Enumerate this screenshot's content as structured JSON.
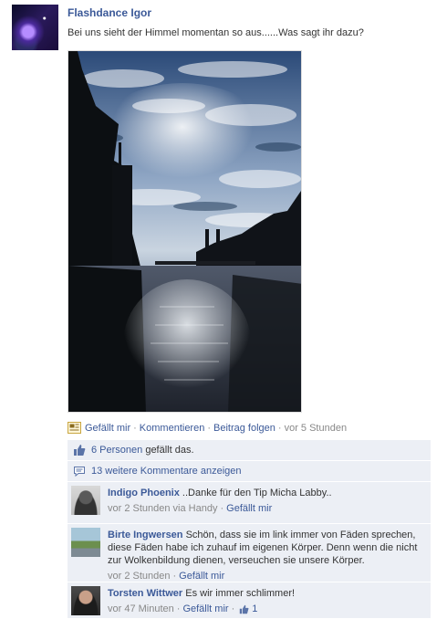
{
  "post": {
    "author": "Flashdance Igor",
    "text": "Bei uns sieht der Himmel momentan so aus......Was sagt ihr dazu?",
    "avatar_icon": "galaxy-avatar",
    "photo_icon": "river-sky-photo"
  },
  "actions": {
    "like": "Gefällt mir",
    "comment": "Kommentieren",
    "follow": "Beitrag folgen",
    "separator": "·",
    "time": "vor 5 Stunden"
  },
  "likes": {
    "count_link": "6 Personen",
    "suffix": " gefällt das.",
    "icon": "thumbs-up-icon"
  },
  "more_comments": {
    "label": "13 weitere Kommentare anzeigen",
    "icon": "comment-bubble-icon"
  },
  "comments": [
    {
      "author": "Indigo Phoenix",
      "text": " ..Danke für den Tip Micha Labby..",
      "time": "vor 2 Stunden via Handy",
      "like": "Gefällt mir"
    },
    {
      "author": "Birte Ingwersen",
      "text": " Schön, dass sie im link immer von Fäden sprechen, diese Fäden habe ich zuhauf im eigenen Körper. Denn wenn die nicht zur Wolkenbildung dienen, verseuchen sie unsere Körper.",
      "time": "vor 2 Stunden",
      "like": "Gefällt mir"
    },
    {
      "author": "Torsten Wittwer",
      "text": " Es wir immer schlimmer!",
      "time": "vor 47 Minuten",
      "like": "Gefällt mir",
      "like_count": "1"
    }
  ],
  "colors": {
    "link": "#3b5998",
    "ufi_background": "#eceff5",
    "meta_text": "#888888"
  }
}
